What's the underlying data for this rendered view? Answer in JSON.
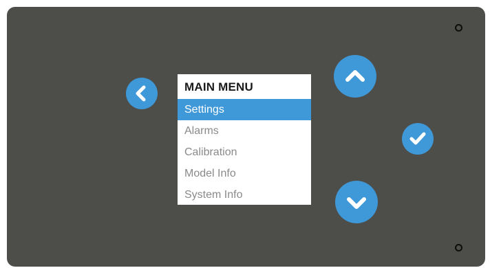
{
  "menu": {
    "title": "MAIN MENU",
    "selected_index": 0,
    "items": [
      {
        "label": "Settings"
      },
      {
        "label": "Alarms"
      },
      {
        "label": "Calibration"
      },
      {
        "label": "Model Info"
      },
      {
        "label": "System Info"
      }
    ]
  },
  "buttons": {
    "back_icon": "chevron-left-icon",
    "up_icon": "chevron-up-icon",
    "ok_icon": "check-icon",
    "down_icon": "chevron-down-icon"
  },
  "colors": {
    "panel": "#4d4e4a",
    "accent": "#3f98d8",
    "screen_bg": "#ffffff",
    "item_text": "#8a8a8a",
    "title_text": "#1a1a1a"
  }
}
